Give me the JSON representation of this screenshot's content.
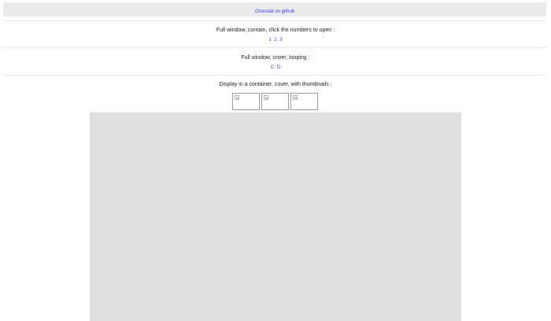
{
  "header": {
    "github_link": "Chocolat on github"
  },
  "sections": {
    "full_window_contain": {
      "title": "Full window, contain, click the numbers to open :",
      "links": [
        "1",
        "2",
        "3"
      ]
    },
    "full_window_cover": {
      "title": "Full window, cover, looping :",
      "links": [
        "C",
        "D"
      ]
    },
    "container_cover": {
      "title": "Display in a container, cover, with thumbnails :"
    }
  },
  "thumbnails": {
    "count": 3,
    "icon": "broken-image-icon"
  },
  "colors": {
    "link": "#2a3cff",
    "topbar_bg": "#ebebeb",
    "container_bg": "#dfdfdf"
  }
}
